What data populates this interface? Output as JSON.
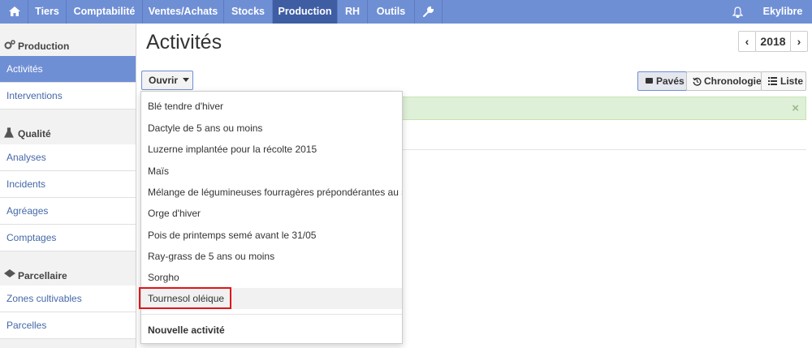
{
  "topnav": {
    "home_icon": "home-icon",
    "items": [
      {
        "label": "Tiers"
      },
      {
        "label": "Comptabilité"
      },
      {
        "label": "Ventes/Achats"
      },
      {
        "label": "Stocks"
      },
      {
        "label": "Production",
        "active": true
      },
      {
        "label": "RH"
      },
      {
        "label": "Outils"
      }
    ],
    "wrench_icon": "wrench-icon",
    "bell_icon": "bell-icon",
    "user_label": "Ekylibre"
  },
  "sidebar": {
    "sections": [
      {
        "label": "Production",
        "icon": "gears-icon",
        "items": [
          {
            "label": "Activités",
            "active": true
          },
          {
            "label": "Interventions"
          }
        ]
      },
      {
        "label": "Qualité",
        "icon": "flask-icon",
        "items": [
          {
            "label": "Analyses"
          },
          {
            "label": "Incidents"
          },
          {
            "label": "Agréages"
          },
          {
            "label": "Comptages"
          }
        ]
      },
      {
        "label": "Parcellaire",
        "icon": "map-icon",
        "items": [
          {
            "label": "Zones cultivables"
          },
          {
            "label": "Parcelles"
          }
        ]
      }
    ]
  },
  "main": {
    "title": "Activités",
    "year": "2018",
    "open_button": "Ouvrir",
    "views": [
      {
        "label": "Pavés",
        "icon": "tiles-icon",
        "active": true
      },
      {
        "label": "Chronologie",
        "icon": "history-icon"
      },
      {
        "label": "Liste",
        "icon": "list-icon"
      }
    ],
    "alert_close": "×"
  },
  "dropdown": {
    "items": [
      "Blé tendre d'hiver",
      "Dactyle de 5 ans ou moins",
      "Luzerne implantée pour la récolte 2015",
      "Maïs",
      "Mélange de légumineuses fourragères prépondérantes au s...",
      "Orge d'hiver",
      "Pois de printemps semé avant le 31/05",
      "Ray-grass de 5 ans ou moins",
      "Sorgho",
      "Tournesol oléique"
    ],
    "new_activity": "Nouvelle activité"
  },
  "colors": {
    "nav_bg": "#6f8fd5",
    "nav_active": "#3f5da3",
    "link": "#4468a8",
    "alert_bg": "#dff0d8",
    "highlight_border": "#e0151a"
  }
}
